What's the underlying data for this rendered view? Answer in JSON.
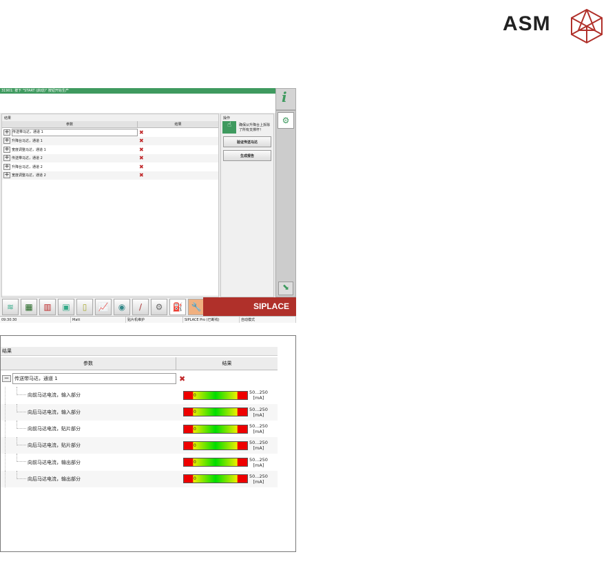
{
  "logo": {
    "text": "ASM",
    "color": "#b0302a"
  },
  "top": {
    "message": "31901: 按下 \"START (启动)\" 按钮开始生产",
    "results_title": "结果",
    "columns": [
      "参数",
      "结果"
    ],
    "rows": [
      "传送带马达，通道 1",
      "升降台马达，通道 1",
      "宽度调整马达，通道 1",
      "传送带马达，通道 2",
      "升降台马达，通道 2",
      "宽度调整马达，通道 2"
    ],
    "ops_title": "操作",
    "ops_hint": "确保从升降台上拆除了所有支撑杆！",
    "buttons": [
      "验证传送马达",
      "生成报告"
    ],
    "brand": "SIPLACE",
    "status": [
      "09:30:30",
      "Matt",
      "贴片机维护",
      "SIPLACE Pro (已断线)",
      "自动模式"
    ],
    "accent": "#3f9a5f"
  },
  "detail": {
    "title": "结果",
    "columns": [
      "参数",
      "结果"
    ],
    "parent": "传送带马达，通道 1",
    "children": [
      {
        "label": "向前马达电流，输入部分",
        "value": "0",
        "range": "50...250",
        "unit": "[mA]"
      },
      {
        "label": "向后马达电流，输入部分",
        "value": "0",
        "range": "50...250",
        "unit": "[mA]"
      },
      {
        "label": "向前马达电流，贴片部分",
        "value": "0",
        "range": "50...250",
        "unit": "[mA]"
      },
      {
        "label": "向后马达电流，贴片部分",
        "value": "0",
        "range": "50...250",
        "unit": "[mA]"
      },
      {
        "label": "向前马达电流，输出部分",
        "value": "0",
        "range": "50...250",
        "unit": "[mA]"
      },
      {
        "label": "向后马达电流，输出部分",
        "value": "0",
        "range": "50...250",
        "unit": "[mA]"
      }
    ]
  }
}
